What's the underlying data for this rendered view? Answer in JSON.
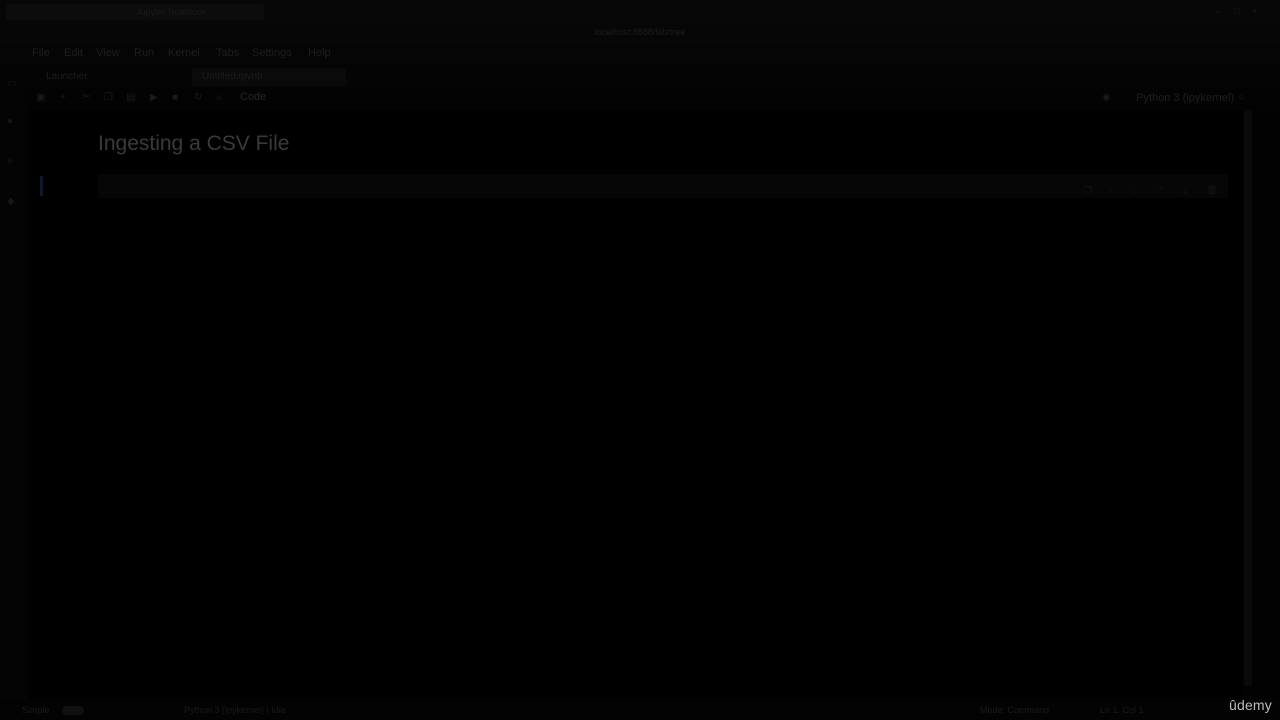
{
  "browser": {
    "tabs": [
      "",
      "Jupyter Notebook"
    ],
    "url": "localhost:8888/lab/tree"
  },
  "menubar": {
    "items": [
      "File",
      "Edit",
      "View",
      "Run",
      "Kernel",
      "Tabs",
      "Settings",
      "Help"
    ]
  },
  "doc_tabs": [
    "Launcher",
    "Untitled.ipynb"
  ],
  "toolbar": {
    "cell_type": "Code",
    "kernel": "Python 3 (ipykernel)"
  },
  "notebook": {
    "heading": "Ingesting a CSV File"
  },
  "statusbar": {
    "left_text": "Simple",
    "mode_text": "Python 3 (ipykernel) | Idle",
    "right_text": "Mode: Command",
    "position_text": "Ln 1, Col 1"
  },
  "watermark": "ûdemy"
}
